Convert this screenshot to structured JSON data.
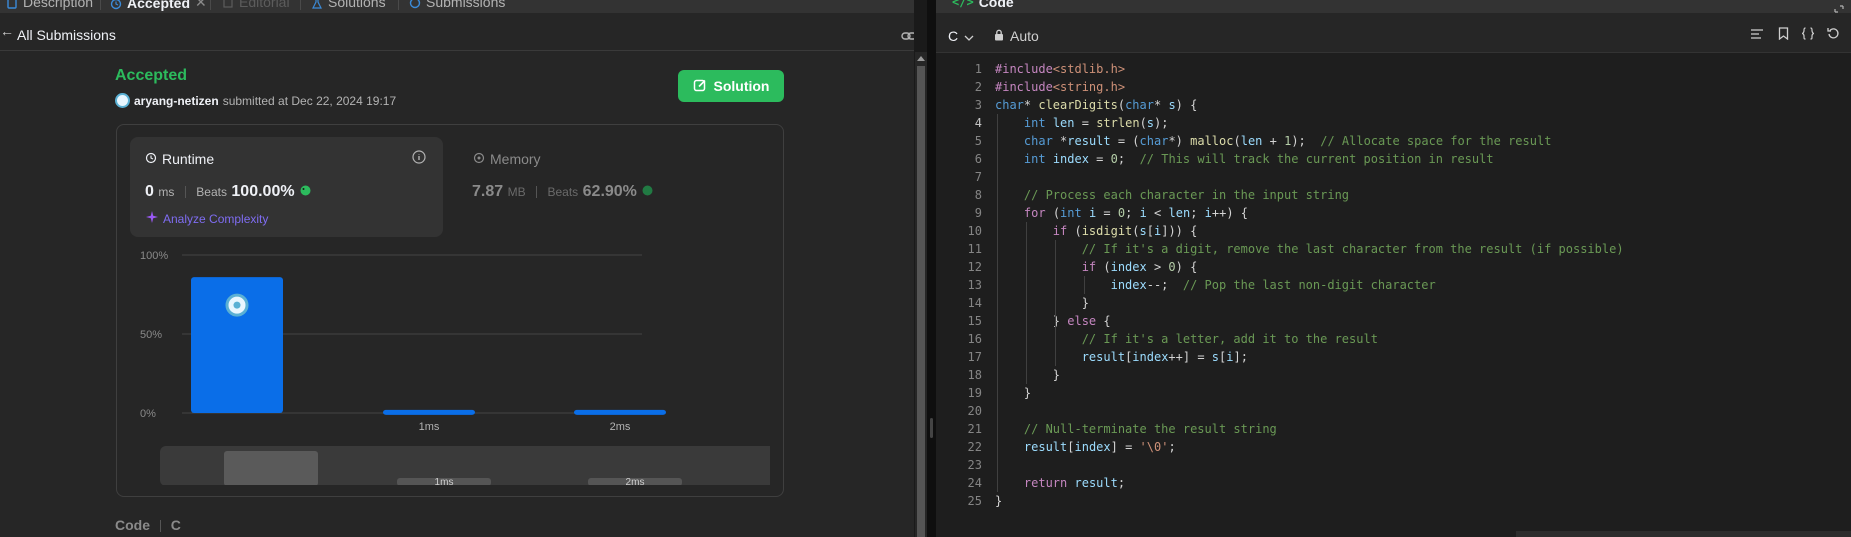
{
  "left_tabs": [
    {
      "label": "Description",
      "state": "normal"
    },
    {
      "label": "Accepted",
      "state": "active"
    },
    {
      "label": "Editorial",
      "state": "disabled"
    },
    {
      "label": "Solutions",
      "state": "normal"
    },
    {
      "label": "Submissions",
      "state": "normal"
    }
  ],
  "subbar": {
    "back_label": "All Submissions"
  },
  "submission": {
    "status": "Accepted",
    "author": "aryang-netizen",
    "submitted_text": "submitted at Dec 22, 2024 19:17"
  },
  "solution_button": "Solution",
  "runtime": {
    "title": "Runtime",
    "value": "0",
    "unit": "ms",
    "beats_label": "Beats",
    "beats_value": "100.00%"
  },
  "memory": {
    "title": "Memory",
    "value": "7.87",
    "unit": "MB",
    "beats_label": "Beats",
    "beats_value": "62.90%"
  },
  "analyze_label": "Analyze Complexity",
  "chart_data": {
    "type": "bar",
    "y_ticks": [
      "100%",
      "50%",
      "0%"
    ],
    "ylim": [
      0,
      100
    ],
    "categories": [
      "0ms",
      "1ms",
      "2ms"
    ],
    "category_labels_shown": [
      "",
      "1ms",
      "2ms"
    ],
    "values": [
      86,
      2,
      2
    ],
    "bar_color": "#0a6ee8",
    "highlight_index": 0,
    "minimap_labels": [
      "",
      "1ms",
      "2ms"
    ]
  },
  "code_section_label": "Code",
  "code_section_lang": "C",
  "editor": {
    "header_title": "Code",
    "language": "C",
    "mode": "Auto",
    "current_line": 4,
    "lines": [
      "#include<stdlib.h>",
      "#include<string.h>",
      "char* clearDigits(char* s) {",
      "    int len = strlen(s);",
      "    char *result = (char*) malloc(len + 1);  // Allocate space for the result",
      "    int index = 0;  // This will track the current position in result",
      "",
      "    // Process each character in the input string",
      "    for (int i = 0; i < len; i++) {",
      "        if (isdigit(s[i])) {",
      "            // If it's a digit, remove the last character from the result (if possible)",
      "            if (index > 0) {",
      "                index--;  // Pop the last non-digit character",
      "            }",
      "        } else {",
      "            // If it's a letter, add it to the result",
      "            result[index++] = s[i];",
      "        }",
      "    }",
      "",
      "    // Null-terminate the result string",
      "    result[index] = '\\0';",
      "",
      "    return result;",
      "}"
    ]
  },
  "colors": {
    "accent_green": "#2cbb5d",
    "bar_blue": "#0a6ee8",
    "analyze_purple": "#7f6df2"
  }
}
